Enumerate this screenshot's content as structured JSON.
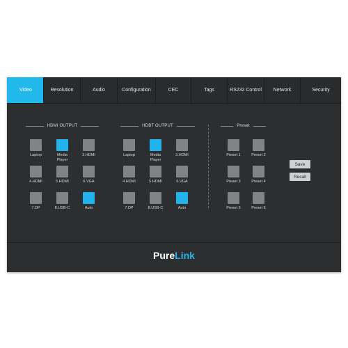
{
  "tabs": [
    "Video",
    "Resolution",
    "Audio",
    "Configuration",
    "CEC",
    "Tags",
    "RS232 Control",
    "Network",
    "Security"
  ],
  "active_tab": "Video",
  "groups": {
    "hdmi_output": {
      "title": "HDMI OUTPUT",
      "buttons": [
        {
          "label": "Laptop",
          "active": false
        },
        {
          "label": "Media\nPlayer",
          "active": true
        },
        {
          "label": "3.HDMI",
          "active": false
        },
        {
          "label": "4.HDMI",
          "active": false
        },
        {
          "label": "5.HDMI",
          "active": false
        },
        {
          "label": "6.VGA",
          "active": false
        },
        {
          "label": "7.DP",
          "active": false
        },
        {
          "label": "8.USB-C",
          "active": false
        },
        {
          "label": "Auto",
          "active": true
        }
      ]
    },
    "hdbt_output": {
      "title": "HDBT OUTPUT",
      "buttons": [
        {
          "label": "Laptop",
          "active": false
        },
        {
          "label": "Media\nPlayer",
          "active": true
        },
        {
          "label": "3.HDMI",
          "active": false
        },
        {
          "label": "4.HDMI",
          "active": false
        },
        {
          "label": "5.HDMI",
          "active": false
        },
        {
          "label": "6.VGA",
          "active": false
        },
        {
          "label": "7.DP",
          "active": false
        },
        {
          "label": "8.USB-C",
          "active": false
        },
        {
          "label": "Auto",
          "active": true
        }
      ]
    },
    "preset": {
      "title": "Preset",
      "buttons": [
        {
          "label": "Preset 1",
          "active": false
        },
        {
          "label": "Preset 2",
          "active": false
        },
        {
          "label": "Preset 3",
          "active": false
        },
        {
          "label": "Preset 4",
          "active": false
        },
        {
          "label": "Preset 5",
          "active": false
        },
        {
          "label": "Preset 6",
          "active": false
        }
      ],
      "save_label": "Save",
      "recall_label": "Recall"
    }
  },
  "logo": {
    "part1": "Pure",
    "part2": "Link"
  },
  "colors": {
    "accent": "#22b3ec",
    "panel": "#2d2e30",
    "button": "#828386"
  }
}
